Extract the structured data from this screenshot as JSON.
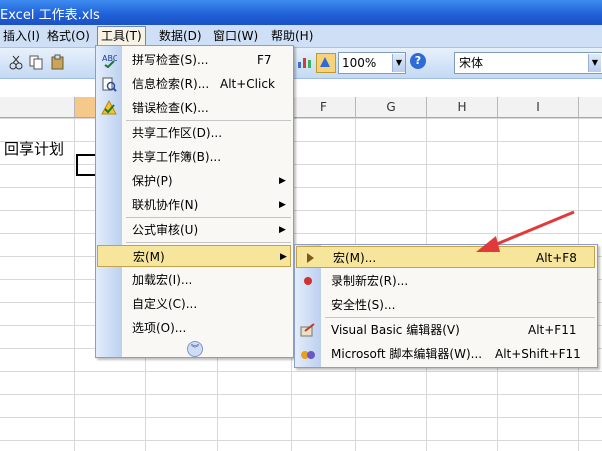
{
  "window": {
    "title": "Excel 工作表.xls"
  },
  "menubar": {
    "items": [
      "插入(I)",
      "格式(O)",
      "工具(T)",
      "数据(D)",
      "窗口(W)",
      "帮助(H)"
    ]
  },
  "toolbar": {
    "zoom": "100%",
    "font": "宋体"
  },
  "columns": [
    "F",
    "G",
    "H",
    "I"
  ],
  "sheet": {
    "cell_text": "回享计划"
  },
  "tools_menu": {
    "items": [
      {
        "label": "拼写检查(S)...",
        "shortcut": "F7",
        "icon": "spellcheck-icon"
      },
      {
        "label": "信息检索(R)...",
        "shortcut": "Alt+Click",
        "icon": "research-icon"
      },
      {
        "label": "错误检查(K)...",
        "shortcut": "",
        "icon": "error-check-icon"
      },
      {
        "label": "共享工作区(D)...",
        "shortcut": ""
      },
      {
        "label": "共享工作簿(B)...",
        "shortcut": ""
      },
      {
        "label": "保护(P)",
        "shortcut": "",
        "submenu": true
      },
      {
        "label": "联机协作(N)",
        "shortcut": "",
        "submenu": true
      },
      {
        "label": "公式审核(U)",
        "shortcut": "",
        "submenu": true
      },
      {
        "label": "宏(M)",
        "shortcut": "",
        "submenu": true
      },
      {
        "label": "加载宏(I)...",
        "shortcut": ""
      },
      {
        "label": "自定义(C)...",
        "shortcut": ""
      },
      {
        "label": "选项(O)...",
        "shortcut": ""
      }
    ],
    "highlighted": "宏(M)"
  },
  "macro_submenu": {
    "items": [
      {
        "label": "宏(M)...",
        "shortcut": "Alt+F8",
        "icon": "play-icon"
      },
      {
        "label": "录制新宏(R)...",
        "shortcut": "",
        "icon": "record-icon"
      },
      {
        "label": "安全性(S)...",
        "shortcut": ""
      },
      {
        "label": "Visual Basic 编辑器(V)",
        "shortcut": "Alt+F11",
        "icon": "vb-editor-icon"
      },
      {
        "label": "Microsoft 脚本编辑器(W)...",
        "shortcut": "Alt+Shift+F11",
        "icon": "script-editor-icon"
      }
    ]
  },
  "colors": {
    "accent_arrow": "#e03a3a",
    "highlight": "#f7e59c",
    "menu_bg": "#f9f8f4"
  }
}
